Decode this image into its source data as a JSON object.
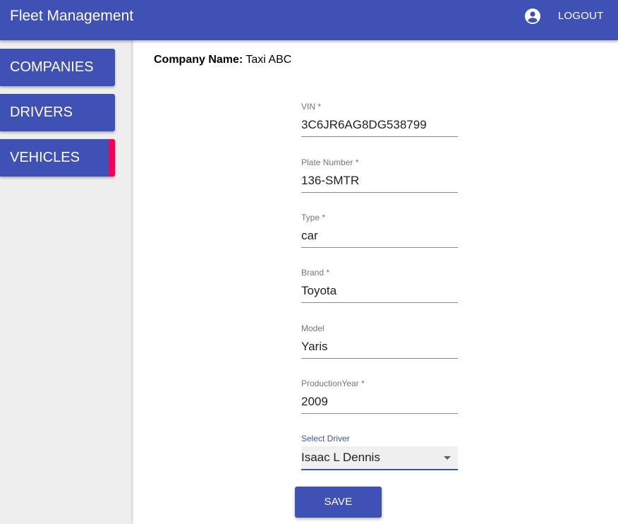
{
  "app": {
    "title": "Fleet Management",
    "logout_label": "LOGOUT"
  },
  "sidebar": {
    "items": [
      {
        "label": "COMPANIES",
        "active": false
      },
      {
        "label": "DRIVERS",
        "active": false
      },
      {
        "label": "VEHICLES",
        "active": true
      }
    ],
    "active_indicator_color": "#f50057"
  },
  "company": {
    "label": "Company Name:",
    "value": "Taxi ABC"
  },
  "form": {
    "fields": [
      {
        "label": "VIN *",
        "value": "3C6JR6AG8DG538799"
      },
      {
        "label": "Plate Number *",
        "value": "136-SMTR"
      },
      {
        "label": "Type *",
        "value": "car"
      },
      {
        "label": "Brand *",
        "value": "Toyota"
      },
      {
        "label": "Model",
        "value": "Yaris"
      },
      {
        "label": "ProductionYear *",
        "value": "2009"
      }
    ],
    "driver_select": {
      "label": "Select Driver",
      "value": "Isaac L Dennis"
    },
    "save_label": "SAVE"
  },
  "colors": {
    "primary": "#3f51b5",
    "accent": "#f50057",
    "sidebar_bg": "#eeeeee"
  }
}
